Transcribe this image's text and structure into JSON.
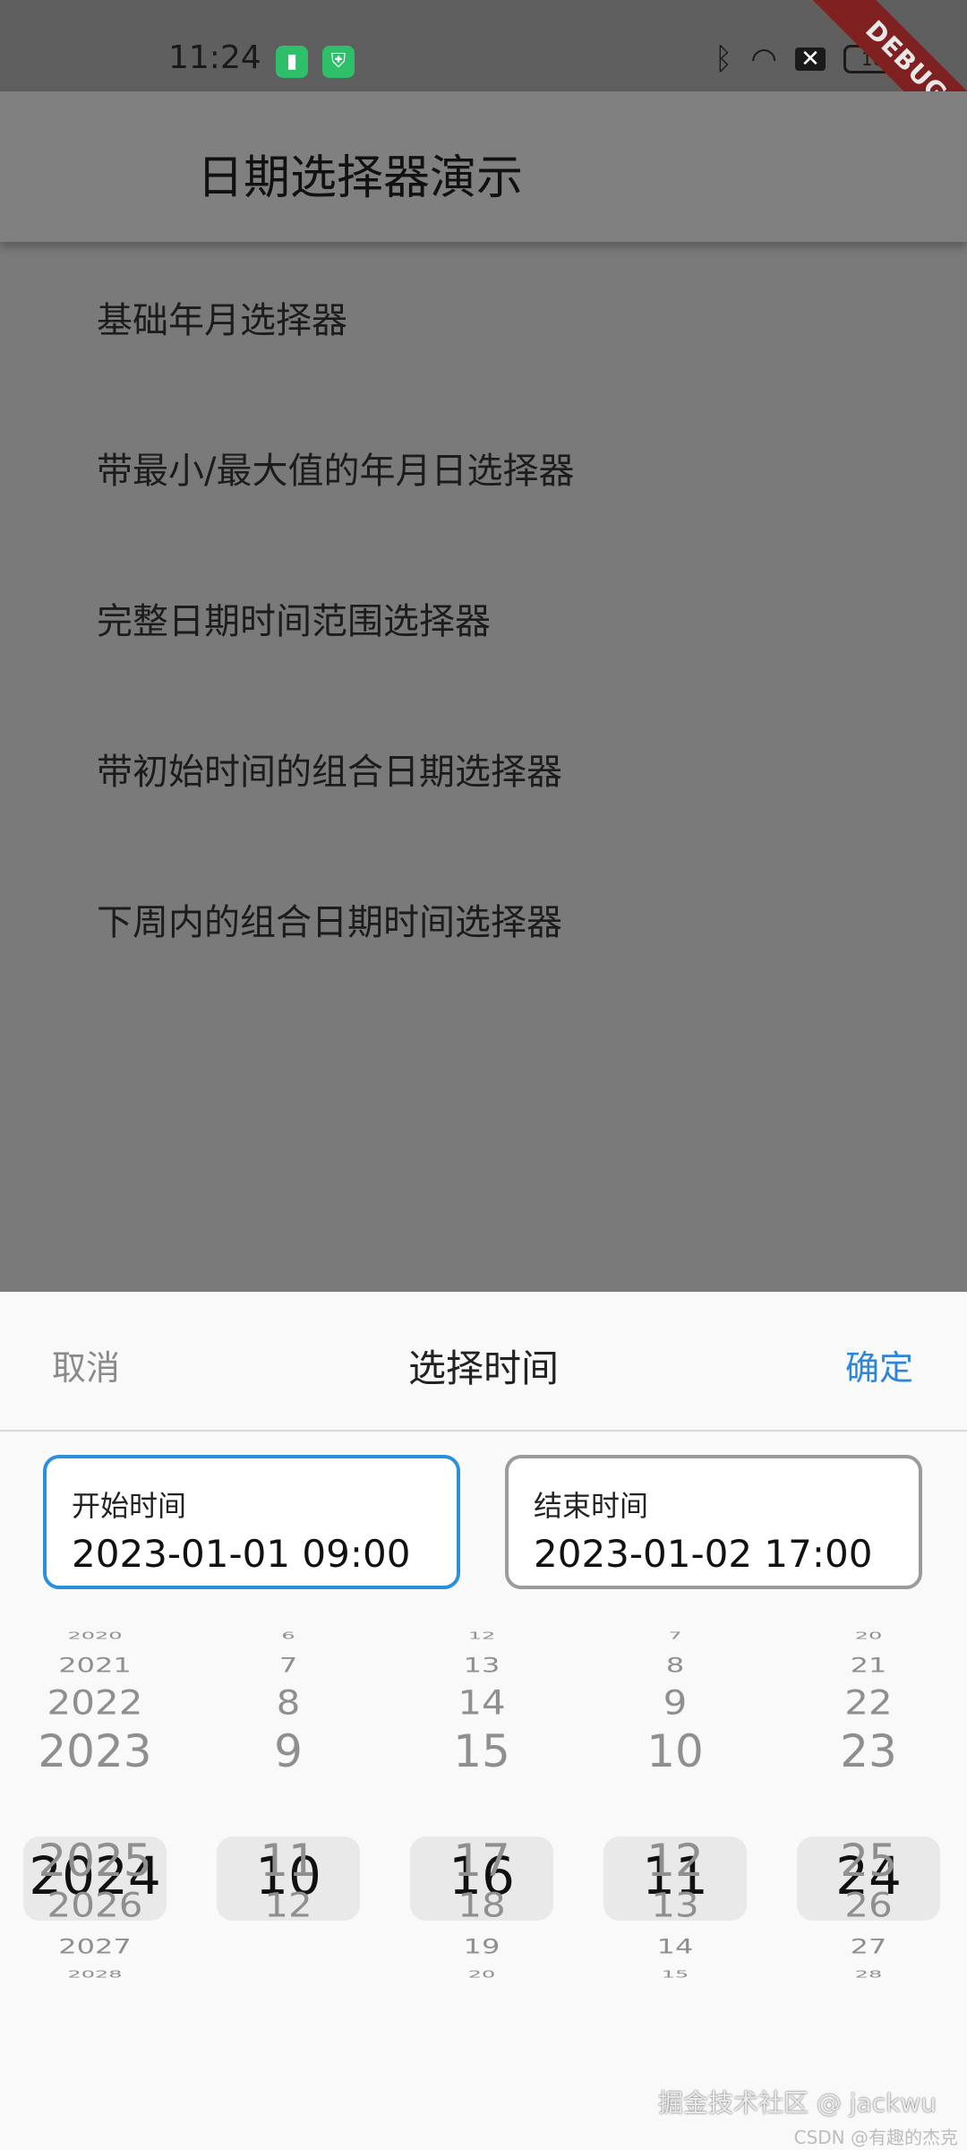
{
  "status": {
    "time": "11:24",
    "battery": "100"
  },
  "debug_banner": "DEBUG",
  "appbar": {
    "title": "日期选择器演示"
  },
  "menu": [
    "基础年月选择器",
    "带最小/最大值的年月日选择器",
    "完整日期时间范围选择器",
    "带初始时间的组合日期选择器",
    "下周内的组合日期时间选择器"
  ],
  "sheet": {
    "cancel": "取消",
    "title": "选择时间",
    "confirm": "确定",
    "start": {
      "label": "开始时间",
      "value": "2023-01-01 09:00"
    },
    "end": {
      "label": "结束时间",
      "value": "2023-01-02 17:00"
    }
  },
  "wheels": [
    {
      "name": "year",
      "items": [
        "2020",
        "2021",
        "2022",
        "2023",
        "2024",
        "2025",
        "2026",
        "2027",
        "2028"
      ],
      "selected": "2024"
    },
    {
      "name": "month",
      "items": [
        "6",
        "7",
        "8",
        "9",
        "10",
        "11",
        "12",
        "",
        ""
      ],
      "selected": "10"
    },
    {
      "name": "day",
      "items": [
        "12",
        "13",
        "14",
        "15",
        "16",
        "17",
        "18",
        "19",
        "20"
      ],
      "selected": "16"
    },
    {
      "name": "hour",
      "items": [
        "7",
        "8",
        "9",
        "10",
        "11",
        "12",
        "13",
        "14",
        "15"
      ],
      "selected": "11"
    },
    {
      "name": "minute",
      "items": [
        "20",
        "21",
        "22",
        "23",
        "24",
        "25",
        "26",
        "27",
        "28"
      ],
      "selected": "24"
    }
  ],
  "watermark": {
    "line1": "掘金技术社区 @ jackwu",
    "line2": "CSDN @有趣的杰克"
  }
}
